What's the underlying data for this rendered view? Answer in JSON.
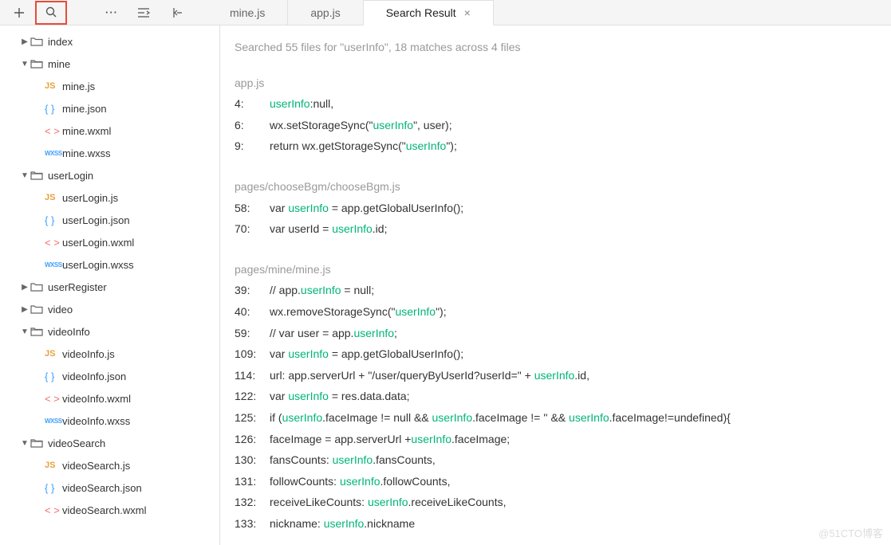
{
  "toolbar": {
    "icons": [
      "plus",
      "search",
      "more",
      "indent",
      "back"
    ]
  },
  "tabs": [
    {
      "label": "mine.js",
      "active": false,
      "closable": false
    },
    {
      "label": "app.js",
      "active": false,
      "closable": false
    },
    {
      "label": "Search Result",
      "active": true,
      "closable": true
    }
  ],
  "tree": [
    {
      "type": "folder",
      "label": "index",
      "expanded": false,
      "depth": 0
    },
    {
      "type": "folder",
      "label": "mine",
      "expanded": true,
      "depth": 0
    },
    {
      "type": "file",
      "label": "mine.js",
      "ft": "js",
      "depth": 1
    },
    {
      "type": "file",
      "label": "mine.json",
      "ft": "json",
      "depth": 1
    },
    {
      "type": "file",
      "label": "mine.wxml",
      "ft": "wxml",
      "depth": 1
    },
    {
      "type": "file",
      "label": "mine.wxss",
      "ft": "wxss",
      "depth": 1
    },
    {
      "type": "folder",
      "label": "userLogin",
      "expanded": true,
      "depth": 0
    },
    {
      "type": "file",
      "label": "userLogin.js",
      "ft": "js",
      "depth": 1
    },
    {
      "type": "file",
      "label": "userLogin.json",
      "ft": "json",
      "depth": 1
    },
    {
      "type": "file",
      "label": "userLogin.wxml",
      "ft": "wxml",
      "depth": 1
    },
    {
      "type": "file",
      "label": "userLogin.wxss",
      "ft": "wxss",
      "depth": 1
    },
    {
      "type": "folder",
      "label": "userRegister",
      "expanded": false,
      "depth": 0
    },
    {
      "type": "folder",
      "label": "video",
      "expanded": false,
      "depth": 0
    },
    {
      "type": "folder",
      "label": "videoInfo",
      "expanded": true,
      "depth": 0
    },
    {
      "type": "file",
      "label": "videoInfo.js",
      "ft": "js",
      "depth": 1
    },
    {
      "type": "file",
      "label": "videoInfo.json",
      "ft": "json",
      "depth": 1
    },
    {
      "type": "file",
      "label": "videoInfo.wxml",
      "ft": "wxml",
      "depth": 1
    },
    {
      "type": "file",
      "label": "videoInfo.wxss",
      "ft": "wxss",
      "depth": 1
    },
    {
      "type": "folder",
      "label": "videoSearch",
      "expanded": true,
      "depth": 0
    },
    {
      "type": "file",
      "label": "videoSearch.js",
      "ft": "js",
      "depth": 1
    },
    {
      "type": "file",
      "label": "videoSearch.json",
      "ft": "json",
      "depth": 1
    },
    {
      "type": "file",
      "label": "videoSearch.wxml",
      "ft": "wxml",
      "depth": 1
    }
  ],
  "search": {
    "summary": "Searched 55 files for \"userInfo\", 18 matches across 4 files",
    "term": "userInfo",
    "groups": [
      {
        "file": "app.js",
        "lines": [
          {
            "n": "4:",
            "segs": [
              [
                "userInfo",
                1
              ],
              [
                ":null,",
                0
              ]
            ]
          },
          {
            "n": "6:",
            "segs": [
              [
                "wx.setStorageSync(\"",
                0
              ],
              [
                "userInfo",
                1
              ],
              [
                "\", user);",
                0
              ]
            ]
          },
          {
            "n": "9:",
            "segs": [
              [
                "return wx.getStorageSync(\"",
                0
              ],
              [
                "userInfo",
                1
              ],
              [
                "\");",
                0
              ]
            ]
          }
        ]
      },
      {
        "file": "pages/chooseBgm/chooseBgm.js",
        "lines": [
          {
            "n": "58:",
            "segs": [
              [
                "var ",
                0
              ],
              [
                "userInfo",
                1
              ],
              [
                " = app.getGlobalUserInfo();",
                0
              ]
            ]
          },
          {
            "n": "70:",
            "segs": [
              [
                "var userId = ",
                0
              ],
              [
                "userInfo",
                1
              ],
              [
                ".id;",
                0
              ]
            ]
          }
        ]
      },
      {
        "file": "pages/mine/mine.js",
        "lines": [
          {
            "n": "39:",
            "segs": [
              [
                "// app.",
                0
              ],
              [
                "userInfo",
                1
              ],
              [
                " = null;",
                0
              ]
            ]
          },
          {
            "n": "40:",
            "segs": [
              [
                "wx.removeStorageSync(\"",
                0
              ],
              [
                "userInfo",
                1
              ],
              [
                "\");",
                0
              ]
            ]
          },
          {
            "n": "59:",
            "segs": [
              [
                "// var user = app.",
                0
              ],
              [
                "userInfo",
                1
              ],
              [
                ";",
                0
              ]
            ]
          },
          {
            "n": "109:",
            "segs": [
              [
                "var ",
                0
              ],
              [
                "userInfo",
                1
              ],
              [
                " = app.getGlobalUserInfo();",
                0
              ]
            ]
          },
          {
            "n": "114:",
            "segs": [
              [
                "url: app.serverUrl + \"/user/queryByUserId?userId=\" + ",
                0
              ],
              [
                "userInfo",
                1
              ],
              [
                ".id,",
                0
              ]
            ]
          },
          {
            "n": "122:",
            "segs": [
              [
                "var ",
                0
              ],
              [
                "userInfo",
                1
              ],
              [
                " = res.data.data;",
                0
              ]
            ]
          },
          {
            "n": "125:",
            "segs": [
              [
                "if (",
                0
              ],
              [
                "userInfo",
                1
              ],
              [
                ".faceImage != null && ",
                0
              ],
              [
                "userInfo",
                1
              ],
              [
                ".faceImage != '' && ",
                0
              ],
              [
                "userInfo",
                1
              ],
              [
                ".faceImage!=undefined){",
                0
              ]
            ]
          },
          {
            "n": "126:",
            "segs": [
              [
                "faceImage = app.serverUrl +",
                0
              ],
              [
                "userInfo",
                1
              ],
              [
                ".faceImage;",
                0
              ]
            ]
          },
          {
            "n": "130:",
            "segs": [
              [
                "fansCounts: ",
                0
              ],
              [
                "userInfo",
                1
              ],
              [
                ".fansCounts,",
                0
              ]
            ]
          },
          {
            "n": "131:",
            "segs": [
              [
                "followCounts: ",
                0
              ],
              [
                "userInfo",
                1
              ],
              [
                ".followCounts,",
                0
              ]
            ]
          },
          {
            "n": "132:",
            "segs": [
              [
                "receiveLikeCounts: ",
                0
              ],
              [
                "userInfo",
                1
              ],
              [
                ".receiveLikeCounts,",
                0
              ]
            ]
          },
          {
            "n": "133:",
            "segs": [
              [
                "nickname: ",
                0
              ],
              [
                "userInfo",
                1
              ],
              [
                ".nickname",
                0
              ]
            ]
          }
        ]
      }
    ]
  },
  "watermark": "@51CTO博客"
}
